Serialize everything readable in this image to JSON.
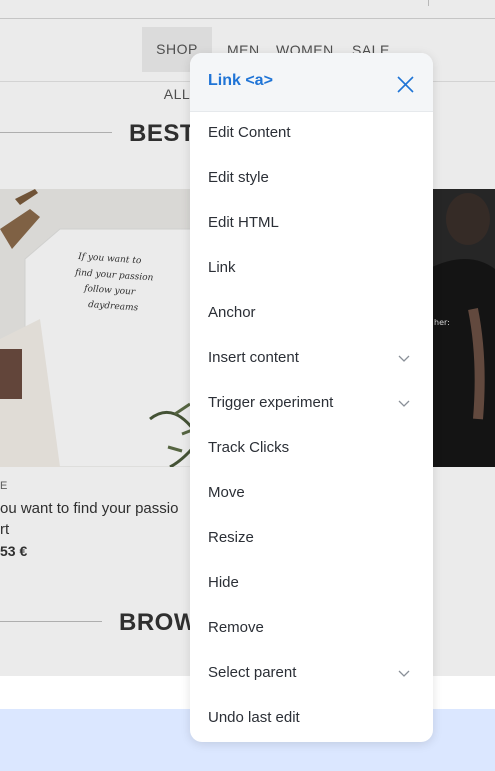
{
  "nav": {
    "items": [
      "SHOP ALL",
      "MEN",
      "WOMEN",
      "SALE"
    ]
  },
  "sections": {
    "best_sellers_title": "BEST S",
    "browse_title": "BROW"
  },
  "product": {
    "brand": "E",
    "image_text": "If you want to find your passion follow your daydreams",
    "title_line1": "ou want to find your passio",
    "title_line2": "rt",
    "price": "53 €"
  },
  "menu": {
    "title": "Link <a>",
    "items": [
      {
        "label": "Edit Content",
        "has_submenu": false
      },
      {
        "label": "Edit style",
        "has_submenu": false
      },
      {
        "label": "Edit HTML",
        "has_submenu": false
      },
      {
        "label": "Link",
        "has_submenu": false
      },
      {
        "label": "Anchor",
        "has_submenu": false
      },
      {
        "label": "Insert content",
        "has_submenu": true
      },
      {
        "label": "Trigger experiment",
        "has_submenu": true
      },
      {
        "label": "Track Clicks",
        "has_submenu": false
      },
      {
        "label": "Move",
        "has_submenu": false
      },
      {
        "label": "Resize",
        "has_submenu": false
      },
      {
        "label": "Hide",
        "has_submenu": false
      },
      {
        "label": "Remove",
        "has_submenu": false
      },
      {
        "label": "Select parent",
        "has_submenu": true
      },
      {
        "label": "Undo last edit",
        "has_submenu": false
      }
    ]
  },
  "colors": {
    "accent": "#1f74d6",
    "menu_header_bg": "#f4f6f8",
    "footer_blue": "#dbe7ff"
  }
}
